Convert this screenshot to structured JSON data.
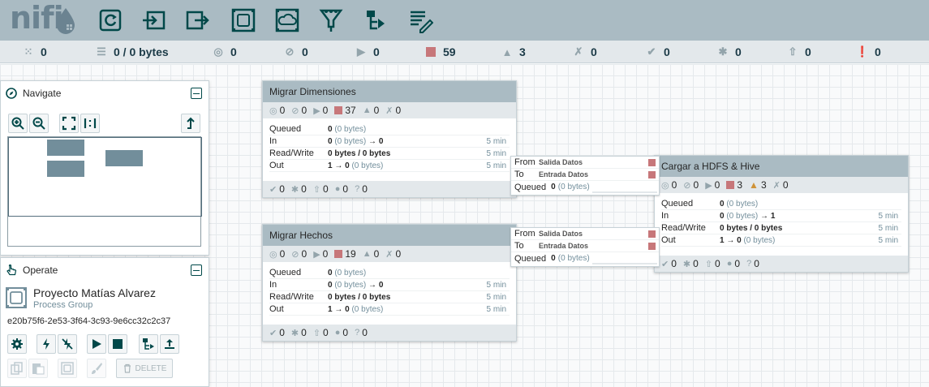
{
  "header": {
    "logo_text": "nifi",
    "toolbar": [
      {
        "icon": "processor-icon"
      },
      {
        "icon": "input-port-icon"
      },
      {
        "icon": "output-port-icon"
      },
      {
        "icon": "process-group-icon"
      },
      {
        "icon": "remote-process-group-icon"
      },
      {
        "icon": "funnel-icon"
      },
      {
        "icon": "template-icon"
      },
      {
        "icon": "label-icon"
      }
    ]
  },
  "status_bar": {
    "clusters": "0",
    "queued": "0 / 0 bytes",
    "transmitting": "0",
    "not_transmitting": "0",
    "running": "0",
    "stopped": "59",
    "invalid": "3",
    "disabled": "0",
    "up_to_date": "0",
    "locally_modified": "0",
    "stale": "0",
    "sync_failure": "0"
  },
  "navigate": {
    "title": "Navigate"
  },
  "operate": {
    "title": "Operate",
    "group_name": "Proyecto Matías Alvarez",
    "group_type": "Process Group",
    "group_id": "e20b75f6-2e53-3f64-3c93-9e6cc32c2c37",
    "delete_label": "DELETE"
  },
  "groups": [
    {
      "name": "Migrar Dimensiones",
      "transmitting": "0",
      "not_transmitting": "0",
      "running": "0",
      "stopped": "37",
      "invalid": "0",
      "disabled": "0",
      "queued_bold": "0",
      "queued_rest": "(0 bytes)",
      "in_bold": "0",
      "in_mid": "(0 bytes)",
      "in_arrow": "→",
      "in_end": "0",
      "in_time": "5 min",
      "rw_value": "0 bytes / 0 bytes",
      "rw_time": "5 min",
      "out_bold": "1",
      "out_arrow": "→",
      "out_count": "0",
      "out_rest": "(0 bytes)",
      "out_time": "5 min",
      "up_to_date": "0",
      "locally_modified": "0",
      "stale": "0",
      "sync_failure": "0",
      "unversioned": "0"
    },
    {
      "name": "Migrar Hechos",
      "transmitting": "0",
      "not_transmitting": "0",
      "running": "0",
      "stopped": "19",
      "invalid": "0",
      "disabled": "0",
      "queued_bold": "0",
      "queued_rest": "(0 bytes)",
      "in_bold": "0",
      "in_mid": "(0 bytes)",
      "in_arrow": "→",
      "in_end": "0",
      "in_time": "5 min",
      "rw_value": "0 bytes / 0 bytes",
      "rw_time": "5 min",
      "out_bold": "1",
      "out_arrow": "→",
      "out_count": "0",
      "out_rest": "(0 bytes)",
      "out_time": "5 min",
      "up_to_date": "0",
      "locally_modified": "0",
      "stale": "0",
      "sync_failure": "0",
      "unversioned": "0"
    },
    {
      "name": "Cargar a HDFS & Hive",
      "transmitting": "0",
      "not_transmitting": "0",
      "running": "0",
      "stopped": "3",
      "invalid": "3",
      "disabled": "0",
      "queued_bold": "0",
      "queued_rest": "(0 bytes)",
      "in_bold": "0",
      "in_mid": "(0 bytes)",
      "in_arrow": "→",
      "in_end": "1",
      "in_time": "5 min",
      "rw_value": "0 bytes / 0 bytes",
      "rw_time": "5 min",
      "out_bold": "1",
      "out_arrow": "→",
      "out_count": "0",
      "out_rest": "(0 bytes)",
      "out_time": "5 min",
      "up_to_date": "0",
      "locally_modified": "0",
      "stale": "0",
      "sync_failure": "0",
      "unversioned": "0"
    }
  ],
  "connections": [
    {
      "from_label": "From",
      "from_value": "Salida Datos",
      "to_label": "To",
      "to_value": "Entrada Datos",
      "queued_label": "Queued",
      "queued_bold": "0",
      "queued_rest": "(0 bytes)"
    },
    {
      "from_label": "From",
      "from_value": "Salida Datos",
      "to_label": "To",
      "to_value": "Entrada Datos",
      "queued_label": "Queued",
      "queued_bold": "0",
      "queued_rest": "(0 bytes)"
    }
  ],
  "labels": {
    "queued": "Queued",
    "in": "In",
    "read_write": "Read/Write",
    "out": "Out"
  },
  "colors": {
    "header": "#aabbc3",
    "stopped": "#c7777a",
    "invalid": "#cf9338",
    "accent": "#004849"
  }
}
